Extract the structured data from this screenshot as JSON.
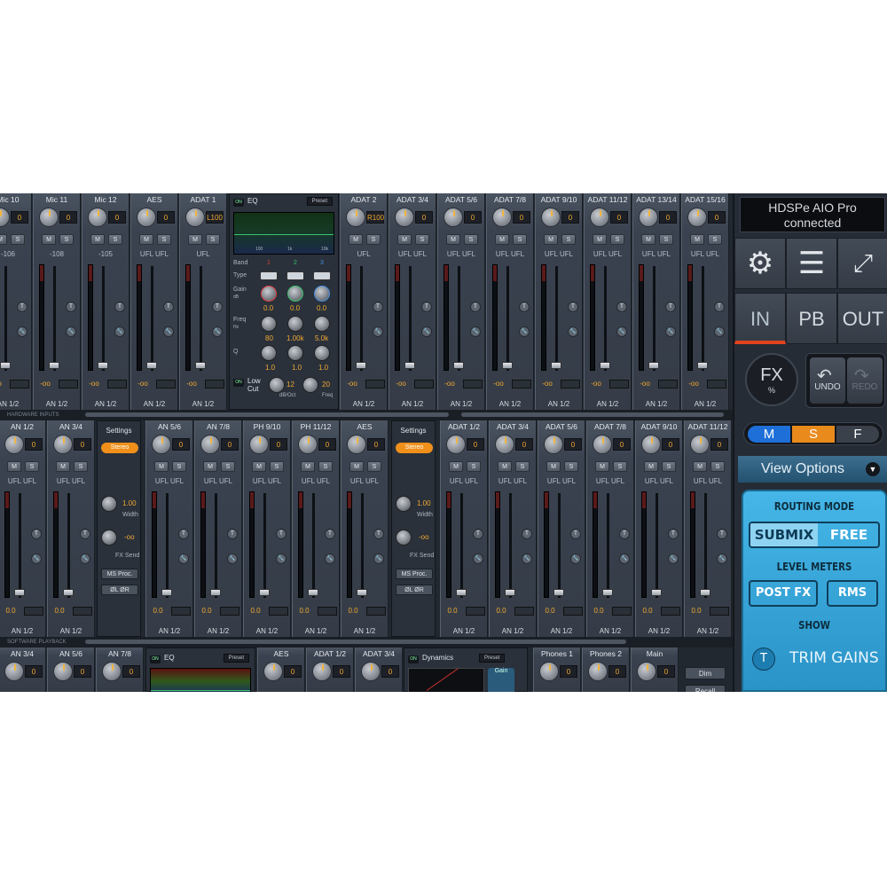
{
  "row1": {
    "channels_left": [
      {
        "name": "Mic 10",
        "value": "0",
        "level": "-106",
        "out": "AN 1/2",
        "db": "-oo"
      },
      {
        "name": "Mic 11",
        "value": "0",
        "level": "-108",
        "out": "AN 1/2",
        "db": "-oo"
      },
      {
        "name": "Mic 12",
        "value": "0",
        "level": "-105",
        "out": "AN 1/2",
        "db": "-oo"
      },
      {
        "name": "AES",
        "value": "0",
        "level": "UFL   UFL",
        "out": "AN 1/2",
        "db": "-oo"
      },
      {
        "name": "ADAT 1",
        "value": "L100",
        "level": "UFL",
        "out": "AN 1/2",
        "db": "-oo"
      }
    ],
    "eq": {
      "title": "EQ",
      "on": "ON",
      "preset": "Preset",
      "band_label": "Band",
      "type_label": "Type",
      "gain_label": "Gain",
      "gain_unit": "dB",
      "freq_label": "Freq",
      "freq_unit": "Hz",
      "q_label": "Q",
      "bands": [
        "1",
        "2",
        "3"
      ],
      "gains": [
        "0.0",
        "0.0",
        "0.0"
      ],
      "freqs": [
        "80",
        "1.00k",
        "5.0k"
      ],
      "qs": [
        "1.0",
        "1.0",
        "1.0"
      ],
      "lowcut_label": "Low Cut",
      "lowcut_val": "12",
      "lowcut_unit": "dB/Oct",
      "lowcut_freq": "20",
      "lowcut_freq_label": "Freq",
      "graph_ticks": [
        "100",
        "1k",
        "10k"
      ]
    },
    "channels_right": [
      {
        "name": "ADAT 2",
        "value": "R100",
        "level": "UFL",
        "out": "AN 1/2",
        "db": "-oo"
      },
      {
        "name": "ADAT 3/4",
        "value": "0",
        "level": "UFL   UFL",
        "out": "AN 1/2",
        "db": "-oo"
      },
      {
        "name": "ADAT 5/6",
        "value": "0",
        "level": "UFL   UFL",
        "out": "AN 1/2",
        "db": "-oo"
      },
      {
        "name": "ADAT 7/8",
        "value": "0",
        "level": "UFL   UFL",
        "out": "AN 1/2",
        "db": "-oo"
      },
      {
        "name": "ADAT 9/10",
        "value": "0",
        "level": "UFL   UFL",
        "out": "AN 1/2",
        "db": "-oo"
      },
      {
        "name": "ADAT 11/12",
        "value": "0",
        "level": "UFL   UFL",
        "out": "AN 1/2",
        "db": "-oo"
      },
      {
        "name": "ADAT 13/14",
        "value": "0",
        "level": "UFL   UFL",
        "out": "AN 1/2",
        "db": "-oo"
      },
      {
        "name": "ADAT 15/16",
        "value": "0",
        "level": "UFL   UFL",
        "out": "AN 1/2",
        "db": "-oo"
      }
    ]
  },
  "section1": "HARDWARE INPUTS",
  "row2": {
    "group1": [
      {
        "name": "AN 1/2",
        "value": "0",
        "level": "UFL   UFL",
        "out": "AN 1/2",
        "db": "0.0"
      },
      {
        "name": "AN 3/4",
        "value": "0",
        "level": "UFL   UFL",
        "out": "AN 1/2",
        "db": "0.0"
      }
    ],
    "settings": {
      "title": "Settings",
      "stereo": "Stereo",
      "width_val": "1.00",
      "width_label": "Width",
      "fxsend_val": "-oo",
      "fxsend_label": "FX Send",
      "msproc": "MS Proc.",
      "phase": "ØL ØR"
    },
    "group2": [
      {
        "name": "AN 5/6",
        "value": "0",
        "level": "UFL   UFL",
        "out": "AN 1/2",
        "db": "0.0"
      },
      {
        "name": "AN 7/8",
        "value": "0",
        "level": "UFL   UFL",
        "out": "AN 1/2",
        "db": "0.0"
      },
      {
        "name": "PH 9/10",
        "value": "0",
        "level": "UFL   UFL",
        "out": "AN 1/2",
        "db": "0.0"
      },
      {
        "name": "PH 11/12",
        "value": "0",
        "level": "UFL   UFL",
        "out": "AN 1/2",
        "db": "0.0"
      },
      {
        "name": "AES",
        "value": "0",
        "level": "UFL   UFL",
        "out": "AN 1/2",
        "db": "0.0"
      }
    ],
    "group3": [
      {
        "name": "ADAT 1/2",
        "value": "0",
        "level": "UFL   UFL",
        "out": "AN 1/2",
        "db": "0.0"
      },
      {
        "name": "ADAT 3/4",
        "value": "0",
        "level": "UFL   UFL",
        "out": "AN 1/2",
        "db": "0.0"
      },
      {
        "name": "ADAT 5/6",
        "value": "0",
        "level": "UFL   UFL",
        "out": "AN 1/2",
        "db": "0.0"
      },
      {
        "name": "ADAT 7/8",
        "value": "0",
        "level": "UFL   UFL",
        "out": "AN 1/2",
        "db": "0.0"
      },
      {
        "name": "ADAT 9/10",
        "value": "0",
        "level": "UFL   UFL",
        "out": "AN 1/2",
        "db": "0.0"
      },
      {
        "name": "ADAT 11/12",
        "value": "0",
        "level": "UFL   UFL",
        "out": "AN 1/2",
        "db": "0.0"
      }
    ]
  },
  "section2": "SOFTWARE PLAYBACK",
  "row3": {
    "a": [
      {
        "name": "AN 3/4",
        "value": "0"
      },
      {
        "name": "AN 5/6",
        "value": "0"
      },
      {
        "name": "AN 7/8",
        "value": "0"
      }
    ],
    "eq": {
      "on": "ON",
      "title": "EQ",
      "preset": "Preset"
    },
    "b": [
      {
        "name": "AES",
        "value": "0"
      },
      {
        "name": "ADAT 1/2",
        "value": "0"
      },
      {
        "name": "ADAT 3/4",
        "value": "0"
      }
    ],
    "dyn": {
      "on": "ON",
      "title": "Dynamics",
      "preset": "Preset",
      "gain": "Gain"
    },
    "c": [
      {
        "name": "Phones 1",
        "value": "0"
      },
      {
        "name": "Phones 2",
        "value": "0"
      },
      {
        "name": "Main",
        "value": "0"
      }
    ],
    "dim": "Dim",
    "recall": "Recall"
  },
  "right": {
    "device": "HDSPe AIO Pro",
    "status": "connected",
    "pages": [
      "IN",
      "PB",
      "OUT"
    ],
    "fx": "FX",
    "fx_unit": "%",
    "undo": "UNDO",
    "redo": "REDO",
    "msf": [
      "M",
      "S",
      "F"
    ],
    "view_options": "View Options",
    "routing_mode": "ROUTING MODE",
    "submix": "SUBMIX",
    "free": "FREE",
    "level_meters": "LEVEL METERS",
    "postfx": "POST FX",
    "rms": "RMS",
    "show": "SHOW",
    "trim_icon": "T",
    "trim_gains": "TRIM GAINS"
  },
  "colors": {
    "accent": "#f0901a",
    "page_active": "#e2421f",
    "view_panel": "#3aa7dc",
    "m_blue": "#1e6fd8",
    "s_orange": "#e88a1c"
  }
}
